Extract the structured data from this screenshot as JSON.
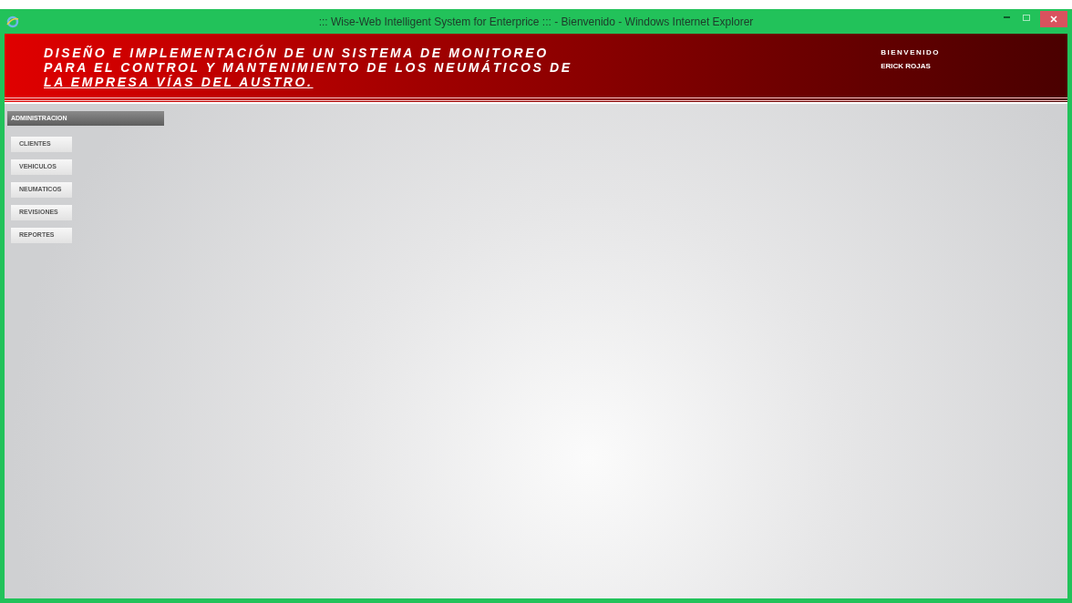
{
  "window": {
    "title": "::: Wise-Web Intelligent System for Enterprice ::: - Bienvenido - Windows Internet Explorer"
  },
  "header": {
    "title_lines": [
      "DISEÑO E IMPLEMENTACIÓN DE UN SISTEMA DE MONITOREO",
      "PARA EL CONTROL Y MANTENIMIENTO DE LOS NEUMÁTICOS DE",
      "LA EMPRESA VÍAS DEL AUSTRO."
    ],
    "greeting": "BIENVENIDO",
    "user": "ERICK ROJAS"
  },
  "sidebar": {
    "title": "ADMINISTRACION",
    "items": [
      "CLIENTES",
      "VEHICULOS",
      "NEUMATICOS",
      "REVISIONES",
      "REPORTES"
    ]
  }
}
